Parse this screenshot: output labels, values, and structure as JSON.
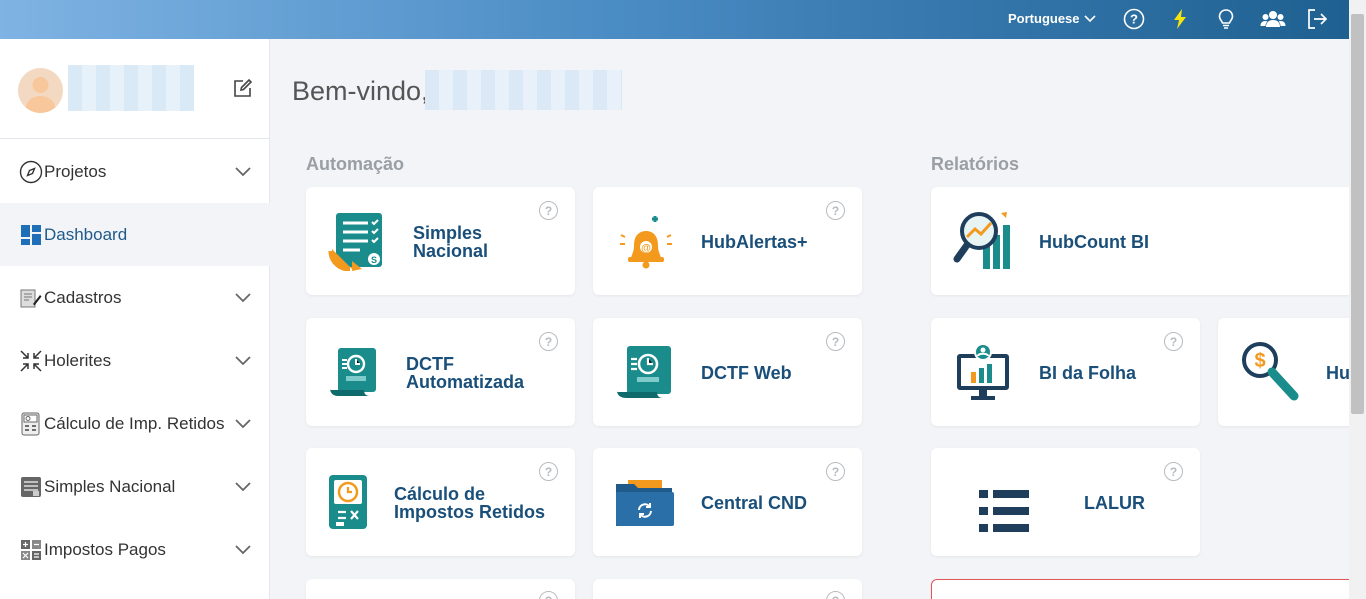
{
  "topbar": {
    "language": "Portuguese",
    "icons": [
      "help-icon",
      "bolt-icon",
      "lightbulb-icon",
      "users-icon",
      "logout-icon"
    ]
  },
  "sidebar": {
    "items": [
      {
        "label": "Projetos",
        "icon": "compass-icon",
        "expandable": true
      },
      {
        "label": "Dashboard",
        "icon": "dashboard-icon",
        "expandable": false,
        "active": true
      },
      {
        "label": "Cadastros",
        "icon": "register-icon",
        "expandable": true
      },
      {
        "label": "Holerites",
        "icon": "compress-icon",
        "expandable": true
      },
      {
        "label": "Cálculo de Imp. Retidos",
        "icon": "calculator-screen-icon",
        "expandable": true
      },
      {
        "label": "Simples Nacional",
        "icon": "document-list-icon",
        "expandable": true
      },
      {
        "label": "Impostos Pagos",
        "icon": "calculator-icon",
        "expandable": true
      }
    ]
  },
  "main": {
    "welcome": "Bem-vindo,",
    "sections": {
      "automacao": "Automação",
      "relatorios": "Relatórios"
    },
    "cards": {
      "simples": {
        "line1": "Simples",
        "line2": "Nacional"
      },
      "hubalertas": "HubAlertas+",
      "dctf_auto": {
        "line1": "DCTF",
        "line2": "Automatizada"
      },
      "dctf_web": "DCTF Web",
      "calculo": {
        "line1": "Cálculo de",
        "line2": "Impostos Retidos"
      },
      "central_cnd": "Central CND",
      "hubcount": "HubCount BI",
      "bi_folha": "BI da Folha",
      "hu_partial": "Hu",
      "lalur": "LALUR",
      "help": "?"
    }
  },
  "colors": {
    "accent": "#1a4f7a",
    "teal": "#1a8c8c",
    "orange": "#f39a1e"
  }
}
